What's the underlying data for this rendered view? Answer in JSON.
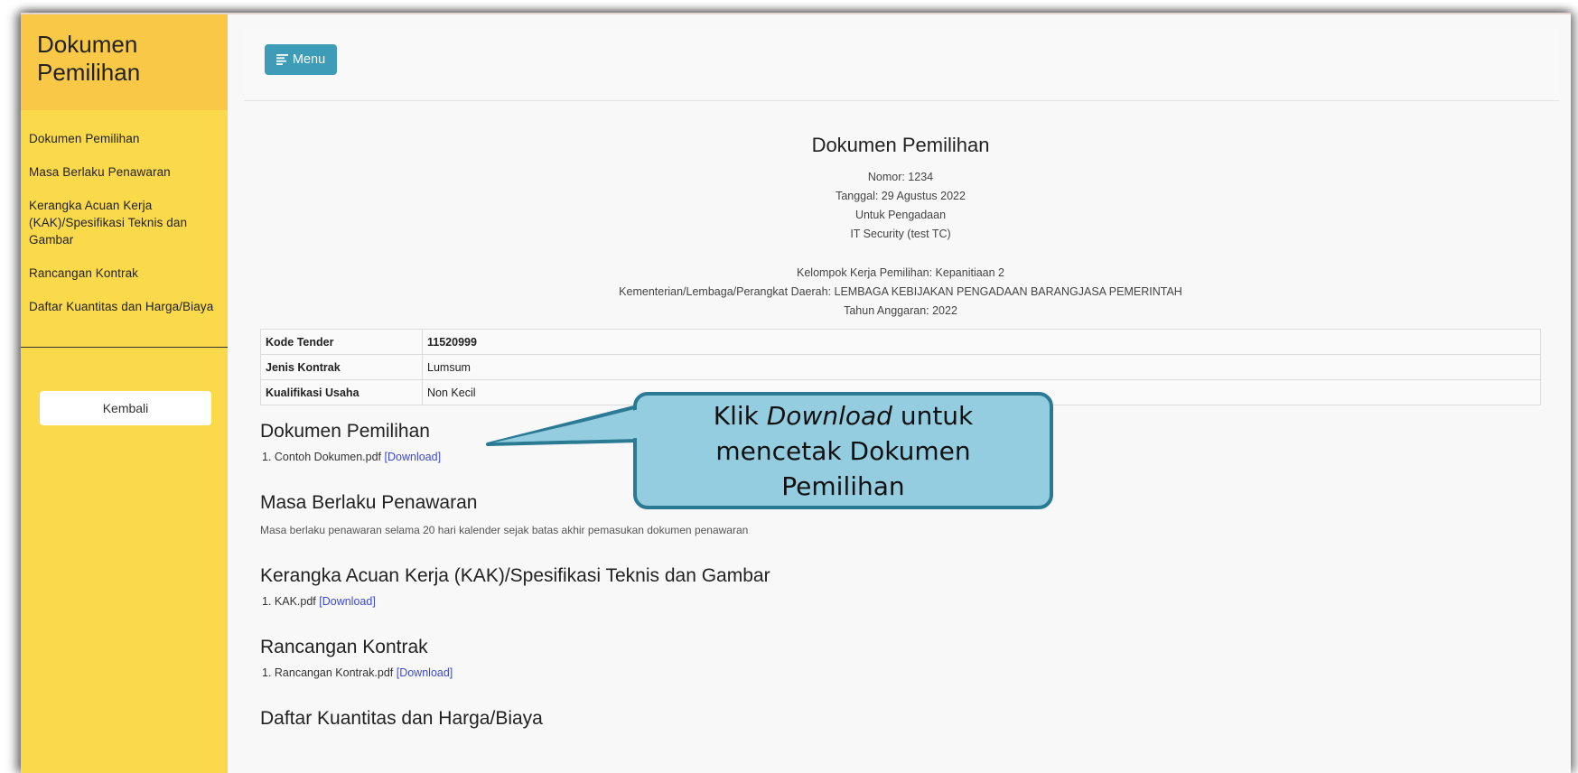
{
  "sidebar": {
    "title_line1": "Dokumen",
    "title_line2": "Pemilihan",
    "items": [
      {
        "label": "Dokumen Pemilihan"
      },
      {
        "label": "Masa Berlaku Penawaran"
      },
      {
        "label": "Kerangka Acuan Kerja (KAK)/Spesifikasi Teknis dan Gambar"
      },
      {
        "label": "Rancangan Kontrak"
      },
      {
        "label": "Daftar Kuantitas dan Harga/Biaya"
      }
    ],
    "back_label": "Kembali"
  },
  "navbar": {
    "menu_label": "Menu",
    "menu_icon": "hamburger-icon"
  },
  "document": {
    "title": "Dokumen Pemilihan",
    "nomor": "Nomor: 1234",
    "tanggal": "Tanggal: 29 Agustus 2022",
    "untuk": "Untuk Pengadaan",
    "paket": "IT Security (test TC)",
    "kelompok": "Kelompok Kerja Pemilihan: Kepanitiaan 2",
    "kementerian": "Kementerian/Lembaga/Perangkat Daerah: LEMBAGA KEBIJAKAN PENGADAAN BARANGJASA PEMERINTAH",
    "tahun": "Tahun Anggaran: 2022"
  },
  "info_table": [
    {
      "key": "Kode Tender",
      "value": "11520999"
    },
    {
      "key": "Jenis Kontrak",
      "value": "Lumsum"
    },
    {
      "key": "Kualifikasi Usaha",
      "value": "Non Kecil"
    }
  ],
  "sections": {
    "dokumen": {
      "heading": "Dokumen Pemilihan",
      "file": "1. Contoh Dokumen.pdf",
      "link": "[Download]"
    },
    "masa": {
      "heading": "Masa Berlaku Penawaran",
      "desc": "Masa berlaku penawaran selama 20 hari kalender sejak batas akhir pemasukan dokumen penawaran"
    },
    "kak": {
      "heading": "Kerangka Acuan Kerja (KAK)/Spesifikasi Teknis dan Gambar",
      "file": "1. KAK.pdf",
      "link": "[Download]"
    },
    "rancangan": {
      "heading": "Rancangan Kontrak",
      "file": "1. Rancangan Kontrak.pdf",
      "link": "[Download]"
    },
    "daftar": {
      "heading": "Daftar Kuantitas dan Harga/Biaya"
    }
  },
  "callout": {
    "text_pre": "Klik ",
    "text_em": "Download",
    "text_post": " untuk mencetak Dokumen Pemilihan"
  },
  "colors": {
    "sidebar_bg": "#fad94a",
    "sidebar_header_bg": "#f9c846",
    "menu_button": "#3d9cb7",
    "link": "#3d49d6",
    "callout_bg": "#94cde0",
    "callout_border": "#2b7a93"
  }
}
